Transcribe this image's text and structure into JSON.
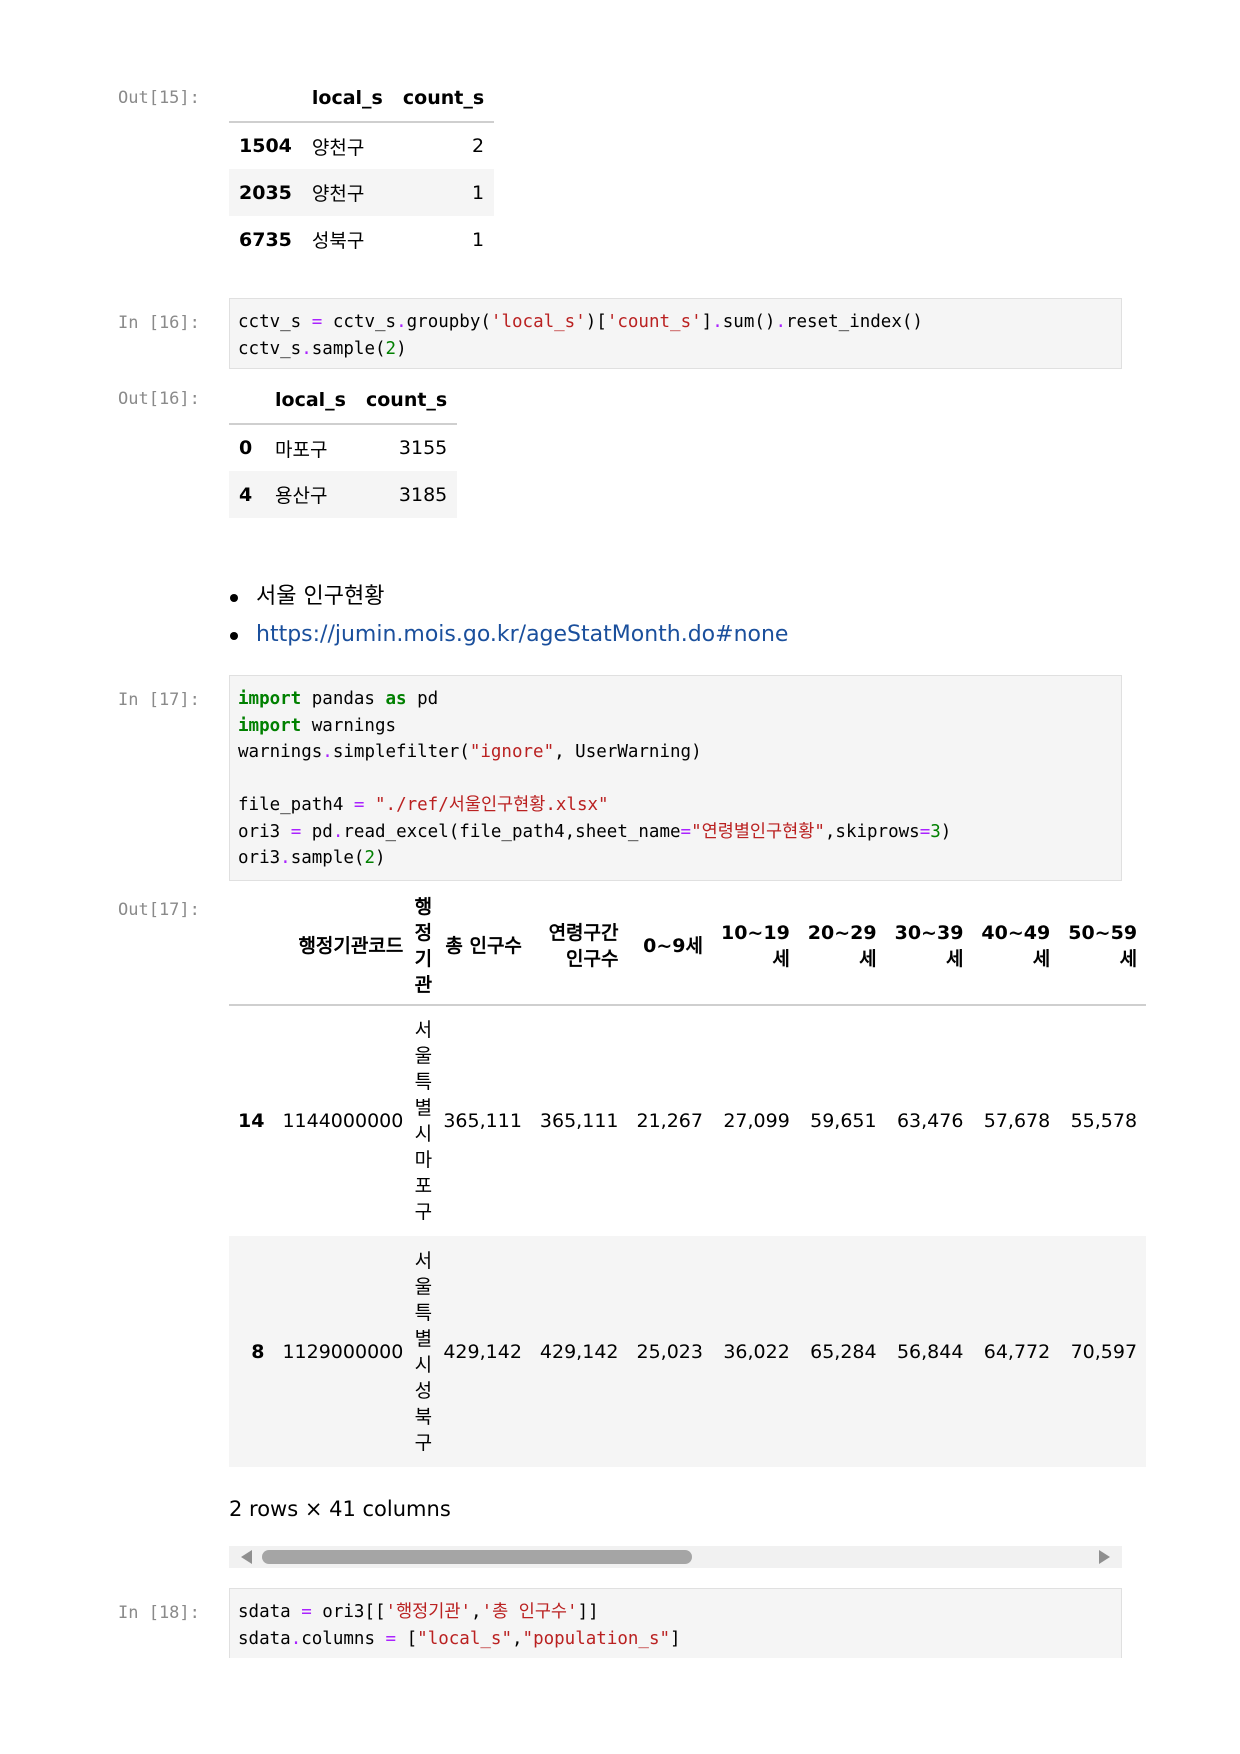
{
  "cells": {
    "out15": {
      "prompt": "Out[15]:",
      "columns": [
        "local_s",
        "count_s"
      ],
      "rows": [
        {
          "index": "1504",
          "local_s": "양천구",
          "count_s": "2"
        },
        {
          "index": "2035",
          "local_s": "양천구",
          "count_s": "1"
        },
        {
          "index": "6735",
          "local_s": "성북구",
          "count_s": "1"
        }
      ]
    },
    "in16": {
      "prompt": "In [16]:",
      "line1": {
        "a": "cctv_s ",
        "b": "=",
        "c": " cctv_s",
        "d": ".",
        "e": "groupby(",
        "f": "'local_s'",
        "g": ")[",
        "h": "'count_s'",
        "i": "]",
        "j": ".",
        "k": "sum()",
        "l": ".",
        "m": "reset_index()"
      },
      "line2": {
        "a": "cctv_s",
        "b": ".",
        "c": "sample(",
        "d": "2",
        "e": ")"
      }
    },
    "out16": {
      "prompt": "Out[16]:",
      "columns": [
        "local_s",
        "count_s"
      ],
      "rows": [
        {
          "index": "0",
          "local_s": "마포구",
          "count_s": "3155"
        },
        {
          "index": "4",
          "local_s": "용산구",
          "count_s": "3185"
        }
      ]
    },
    "markdown": {
      "bullet1": "서울 인구현황",
      "bullet2": "https://jumin.mois.go.kr/ageStatMonth.do#none"
    },
    "in17": {
      "prompt": "In [17]:",
      "l1": {
        "kw1": "import",
        "t1": " pandas ",
        "kw2": "as",
        "t2": " pd"
      },
      "l2": {
        "kw1": "import",
        "t1": " warnings"
      },
      "l3": {
        "t1": "warnings",
        "d1": ".",
        "t2": "simplefilter(",
        "s1": "\"ignore\"",
        "t3": ", UserWarning)"
      },
      "l5": {
        "t1": "file_path4 ",
        "o1": "=",
        "t2": " ",
        "s1": "\"./ref/서울인구현황.xlsx\""
      },
      "l6": {
        "t1": "ori3 ",
        "o1": "=",
        "t2": " pd",
        "d1": ".",
        "t3": "read_excel(file_path4,sheet_name",
        "o2": "=",
        "s1": "\"연령별인구현황\"",
        "t4": ",skiprows",
        "o3": "=",
        "n1": "3",
        "t5": ")"
      },
      "l7": {
        "t1": "ori3",
        "d1": ".",
        "t2": "sample(",
        "n1": "2",
        "t3": ")"
      }
    },
    "out17": {
      "prompt": "Out[17]:",
      "columns": [
        "행정기관코드",
        "행정기관",
        "총 인구수",
        "연령구간인구수",
        "0~9세",
        "10~19세",
        "20~29세",
        "30~39세",
        "40~49세",
        "50~59세"
      ],
      "rows": [
        {
          "index": "14",
          "code": "1144000000",
          "name": "서울특별시마포구",
          "total": "365,111",
          "range": "365,111",
          "a0": "21,267",
          "a10": "27,099",
          "a20": "59,651",
          "a30": "63,476",
          "a40": "57,678",
          "a50": "55,578"
        },
        {
          "index": "8",
          "code": "1129000000",
          "name": "서울특별시성북구",
          "total": "429,142",
          "range": "429,142",
          "a0": "25,023",
          "a10": "36,022",
          "a20": "65,284",
          "a30": "56,844",
          "a40": "64,772",
          "a50": "70,597"
        }
      ],
      "rows_info": "2 rows × 41 columns"
    },
    "in18": {
      "prompt": "In [18]:",
      "l1": {
        "t1": "sdata ",
        "o1": "=",
        "t2": " ori3[[",
        "s1": "'행정기관'",
        "t3": ",",
        "s2": "'총 인구수'",
        "t4": "]]"
      },
      "l2": {
        "t1": "sdata",
        "d1": ".",
        "t2": "columns ",
        "o1": "=",
        "t3": " [",
        "s1": "\"local_s\"",
        "t4": ",",
        "s2": "\"population_s\"",
        "t5": "]"
      }
    }
  },
  "icons": {
    "scroll_left": "triangle-left-icon",
    "scroll_right": "triangle-right-icon"
  }
}
